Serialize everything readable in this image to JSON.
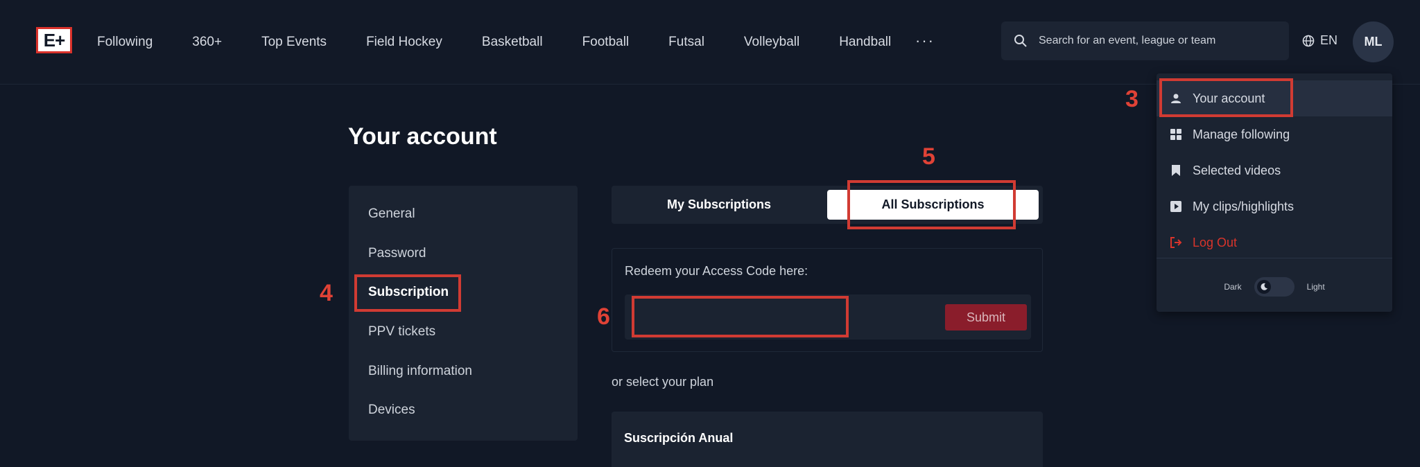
{
  "logo": {
    "text": "E+"
  },
  "nav": {
    "items": [
      "Following",
      "360+",
      "Top Events",
      "Field Hockey",
      "Basketball",
      "Football",
      "Futsal",
      "Volleyball",
      "Handball"
    ],
    "more": "···"
  },
  "search": {
    "placeholder": "Search for an event, league or team"
  },
  "lang": {
    "label": "EN"
  },
  "avatar": {
    "initials": "ML"
  },
  "dropdown": {
    "items": [
      {
        "label": "Your account",
        "icon": "user-icon"
      },
      {
        "label": "Manage following",
        "icon": "grid-icon"
      },
      {
        "label": "Selected videos",
        "icon": "bookmark-icon"
      },
      {
        "label": "My clips/highlights",
        "icon": "clip-icon"
      },
      {
        "label": "Log Out",
        "icon": "logout-icon"
      }
    ],
    "theme": {
      "dark": "Dark",
      "light": "Light"
    }
  },
  "page": {
    "title": "Your account"
  },
  "side_menu": {
    "items": [
      "General",
      "Password",
      "Subscription",
      "PPV tickets",
      "Billing information",
      "Devices"
    ],
    "active": "Subscription"
  },
  "tabs": {
    "my": "My Subscriptions",
    "all": "All Subscriptions",
    "active": "All Subscriptions"
  },
  "redeem": {
    "label": "Redeem your Access Code here:",
    "value": "",
    "submit": "Submit"
  },
  "plans": {
    "intro": "or select your plan",
    "first_plan": "Suscripción Anual"
  },
  "annotations": {
    "n3": "3",
    "n4": "4",
    "n5": "5",
    "n6": "6"
  },
  "colors": {
    "background": "#111826",
    "panel": "#1b2331",
    "accent_red": "#d9322b",
    "submit": "#8a1d2b"
  }
}
